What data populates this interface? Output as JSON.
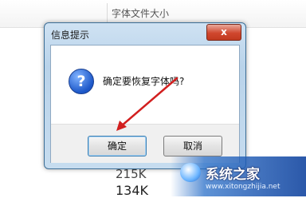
{
  "background": {
    "column_header": "字体文件大小",
    "sizes": [
      "215K",
      "134K"
    ]
  },
  "dialog": {
    "title": "信息提示",
    "close_glyph": "x",
    "icon_glyph": "?",
    "message": "确定要恢复字体吗?",
    "ok_label": "确定",
    "cancel_label": "取消"
  },
  "watermark": {
    "site_name": "系统之家",
    "url": "www.xitongzhijia.net"
  },
  "colors": {
    "title_bar": "#b9d3ea",
    "close_button": "#c1391f",
    "arrow": "#d21f1f"
  }
}
